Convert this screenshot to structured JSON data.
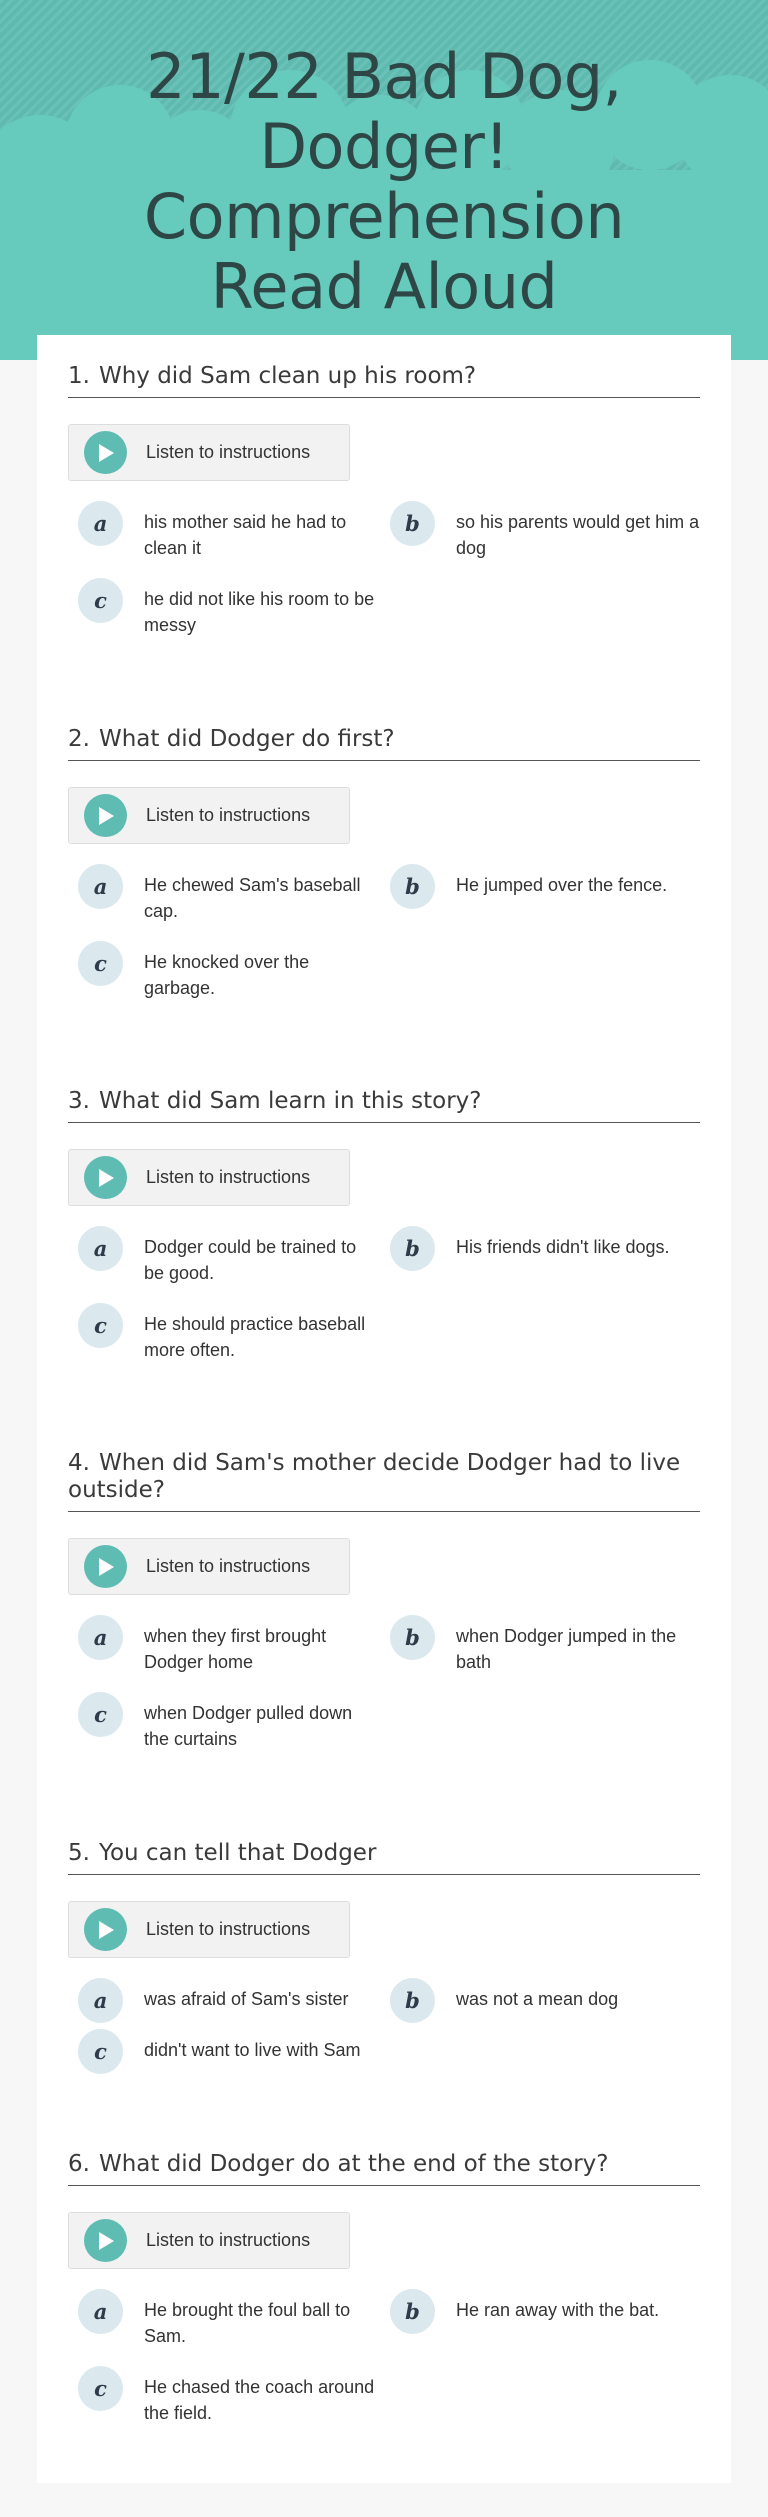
{
  "page": {
    "title": "21/22 Bad Dog, Dodger! Comprehension Read Aloud"
  },
  "colors": {
    "hero": "#5fbcb2",
    "hero_cloud": "#66cbbd",
    "accent": "#5fbcb2",
    "letter_bg": "#dbe9ee",
    "sheet": "#ffffff",
    "page_bg": "#f7f7f7"
  },
  "icons": {
    "play": "play-icon"
  },
  "listen_label": "Listen to instructions",
  "questions": [
    {
      "number": "1.",
      "text": "Why did Sam clean up his room?",
      "choices": [
        {
          "letter": "a",
          "text": "his mother said he had to clean it"
        },
        {
          "letter": "b",
          "text": "so his parents would get him a dog"
        },
        {
          "letter": "c",
          "text": "he did not like his room to be messy"
        }
      ]
    },
    {
      "number": "2.",
      "text": "What did Dodger do first?",
      "choices": [
        {
          "letter": "a",
          "text": "He chewed Sam's baseball cap."
        },
        {
          "letter": "b",
          "text": "He jumped over the fence."
        },
        {
          "letter": "c",
          "text": "He knocked over the garbage."
        }
      ]
    },
    {
      "number": "3.",
      "text": "What did Sam learn in this story?",
      "choices": [
        {
          "letter": "a",
          "text": "Dodger could be trained to be good."
        },
        {
          "letter": "b",
          "text": "His friends didn't like dogs."
        },
        {
          "letter": "c",
          "text": "He should practice baseball more often."
        }
      ]
    },
    {
      "number": "4.",
      "text": "When did Sam's mother decide Dodger had to live outside?",
      "choices": [
        {
          "letter": "a",
          "text": "when they first brought Dodger home"
        },
        {
          "letter": "b",
          "text": "when Dodger jumped in the bath"
        },
        {
          "letter": "c",
          "text": "when Dodger pulled down the curtains"
        }
      ]
    },
    {
      "number": "5.",
      "text": "You can tell that Dodger",
      "choices": [
        {
          "letter": "a",
          "text": "was afraid of Sam's sister"
        },
        {
          "letter": "b",
          "text": "was not a mean dog"
        },
        {
          "letter": "c",
          "text": "didn't want to live with Sam"
        }
      ]
    },
    {
      "number": "6.",
      "text": "What did Dodger do at the end of the story?",
      "choices": [
        {
          "letter": "a",
          "text": "He brought the foul ball to Sam."
        },
        {
          "letter": "b",
          "text": "He ran away with the bat."
        },
        {
          "letter": "c",
          "text": "He chased the coach around the field."
        }
      ]
    }
  ]
}
